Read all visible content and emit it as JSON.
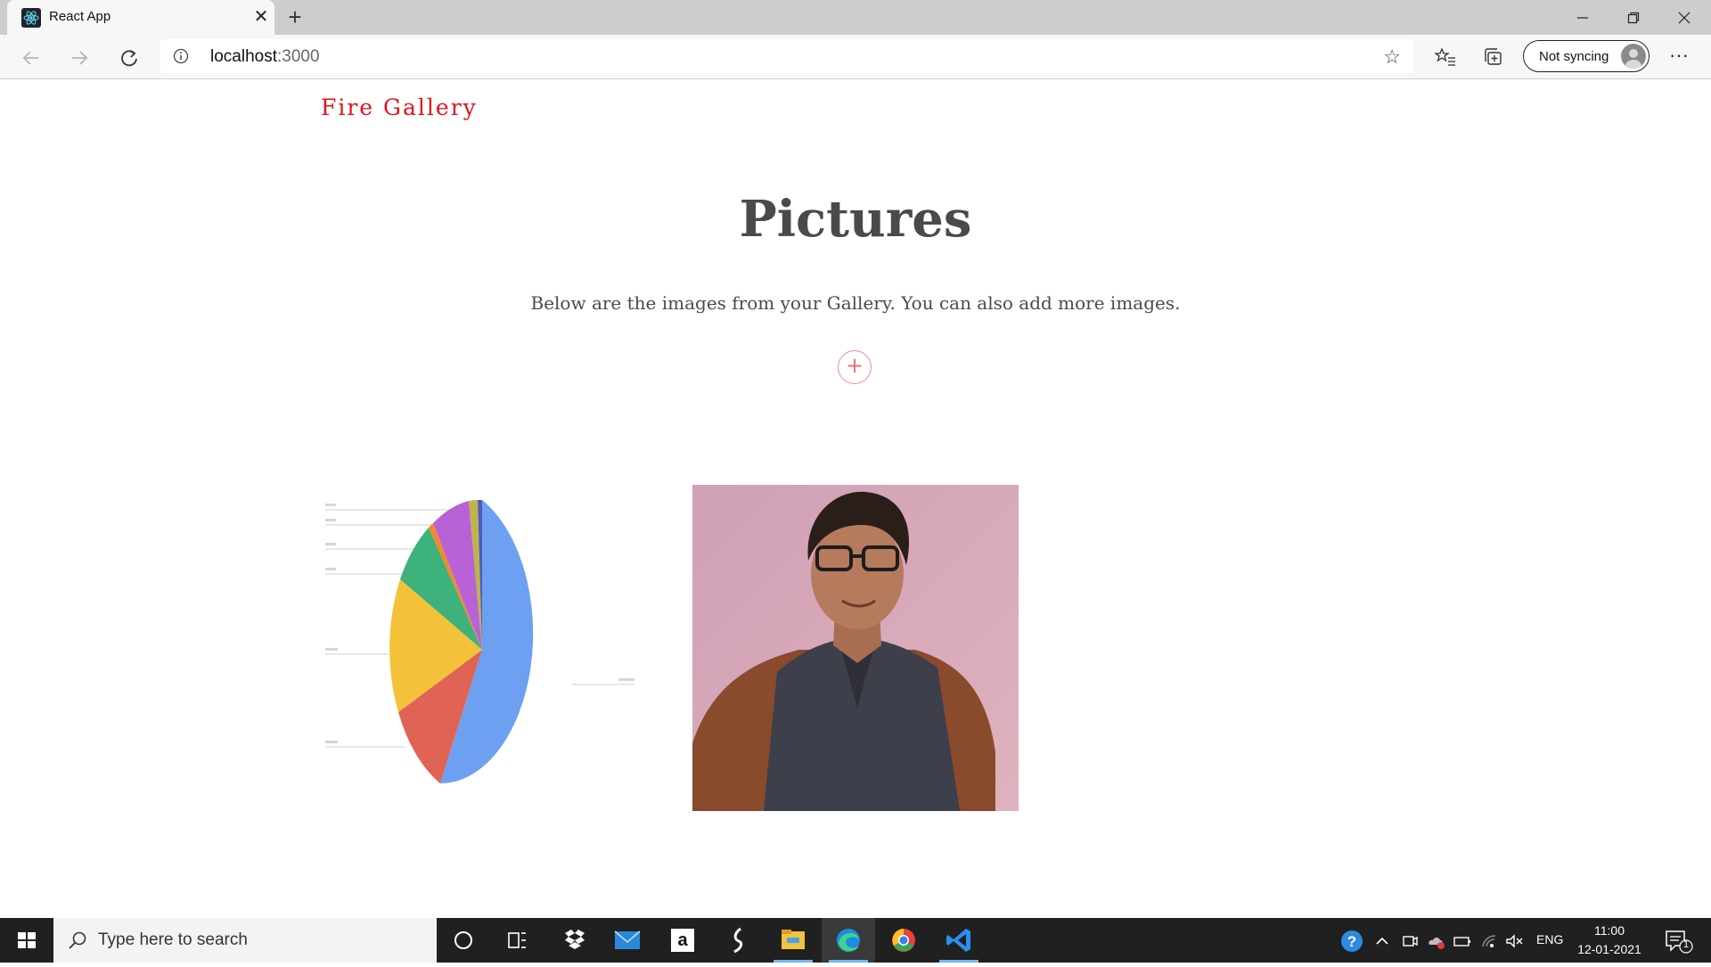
{
  "browser": {
    "tab_title": "React App",
    "address": {
      "host": "localhost",
      "port": ":3000"
    },
    "sync_label": "Not syncing",
    "window_controls": [
      "minimize-icon",
      "restore-icon",
      "close-icon"
    ]
  },
  "page": {
    "brand": "Fire Gallery",
    "heading": "Pictures",
    "subtitle": "Below are the images from your Gallery. You can also add more images.",
    "add_button_symbol": "+",
    "accent_color": "#e3111b",
    "images": [
      {
        "kind": "pie-chart-thumbnail"
      },
      {
        "kind": "portrait-photo"
      }
    ]
  },
  "taskbar": {
    "search_placeholder": "Type here to search",
    "apps": [
      "cortana-icon",
      "task-view-icon",
      "dropbox-icon",
      "mail-icon",
      "amazon-icon",
      "cursive-app-icon",
      "file-explorer-icon",
      "edge-icon",
      "chrome-icon",
      "vscode-icon"
    ],
    "language": "ENG",
    "time": "11:00",
    "date": "12-01-2021",
    "notification_count": "1"
  }
}
